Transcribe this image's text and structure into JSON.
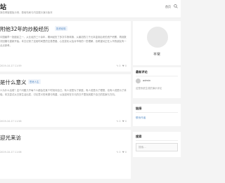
{
  "header": {
    "title": "站",
    "description": "静态博客模板示例，基础布局与内容展示演示版本",
    "nav_label": "首页"
  },
  "posts": [
    {
      "title": "附他32年的炒股经历",
      "tag": "投资经验",
      "excerpt": "中国最早一批股民之一，从业经历三十余年，期间经历了多次牛熊转换，从最初的几千元本金到后来的资产积累，再到数次回撤与重新开始。本文记录了这段时间里的交易思路、心态变化以及对市场的一些理解，也希望对正在入市的朋友有一点点参考。",
      "date": "2019-10-17 11:59",
      "comments": "0",
      "likes": "0"
    },
    {
      "title": "是什么意义",
      "tag": "思考人生",
      "excerpt": "人为什么活着？这个问题几乎每个人都会在某个时刻问自己。有人说是为了家庭，有人说是为了理想，也有人说是为了体验。本文尝试从日常生活出发，讨论意义的来源与构建，以及如何在平凡的日子里找到属于自己的答案与方向。",
      "date": "2019-10-17 11:58",
      "comments": "0",
      "likes": "0"
    },
    {
      "title": "迎光来访",
      "tag": "",
      "excerpt": "",
      "date": "2019-10-17 11:06",
      "comments": "0",
      "likes": "0"
    }
  ],
  "sidebar": {
    "profile_name": "平常",
    "recent_title": "最新评论",
    "comment_user": "admin",
    "comment_text": "这是系统生成的演示评论",
    "links_title": "链接",
    "links_item": "联系作者",
    "search_title": "搜索",
    "search_placeholder": "搜索..."
  }
}
